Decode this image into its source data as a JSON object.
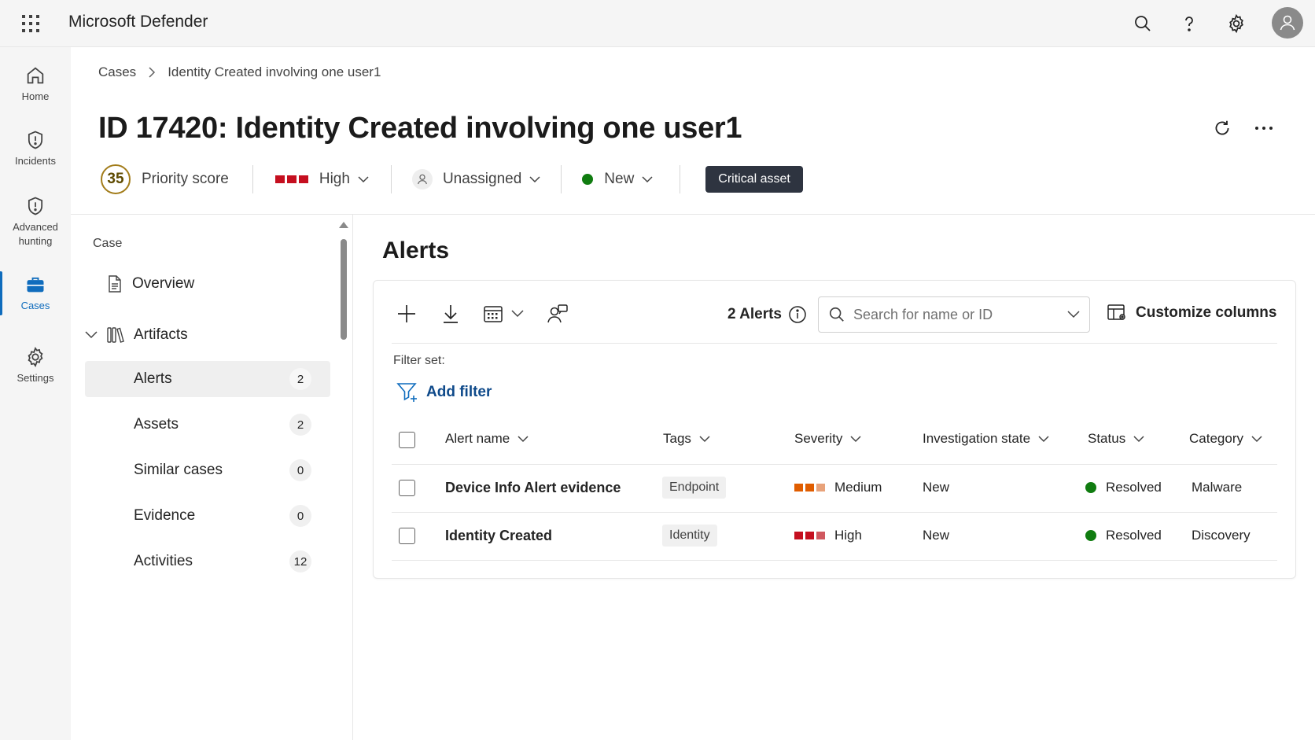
{
  "app": {
    "title": "Microsoft Defender"
  },
  "rail": {
    "items": [
      {
        "label": "Home"
      },
      {
        "label": "Incidents"
      },
      {
        "label": "Advanced hunting"
      },
      {
        "label": "Cases"
      },
      {
        "label": "Settings"
      }
    ]
  },
  "breadcrumb": {
    "root": "Cases",
    "current": "Identity Created involving one user1"
  },
  "case": {
    "title": "ID 17420: Identity Created involving one user1",
    "priority_score": "35",
    "priority_label": "Priority score",
    "severity": "High",
    "assignee": "Unassigned",
    "status": "New",
    "badge": "Critical asset"
  },
  "nav": {
    "section": "Case",
    "overview": "Overview",
    "artifacts": "Artifacts",
    "items": [
      {
        "label": "Alerts",
        "count": "2"
      },
      {
        "label": "Assets",
        "count": "2"
      },
      {
        "label": "Similar cases",
        "count": "0"
      },
      {
        "label": "Evidence",
        "count": "0"
      },
      {
        "label": "Activities",
        "count": "12"
      }
    ]
  },
  "alerts": {
    "title": "Alerts",
    "count_label": "2 Alerts",
    "search_placeholder": "Search for name or ID",
    "customize_label": "Customize columns",
    "filter_set_label": "Filter set:",
    "add_filter_label": "Add filter",
    "columns": {
      "name": "Alert name",
      "tags": "Tags",
      "severity": "Severity",
      "investigation": "Investigation state",
      "status": "Status",
      "category": "Category"
    },
    "rows": [
      {
        "name": "Device Info Alert evidence",
        "tag": "Endpoint",
        "severity": "Medium",
        "investigation": "New",
        "status": "Resolved",
        "category": "Malware"
      },
      {
        "name": "Identity Created",
        "tag": "Identity",
        "severity": "High",
        "investigation": "New",
        "status": "Resolved",
        "category": "Discovery"
      }
    ]
  },
  "colors": {
    "accent": "#0f6cbd",
    "severity_high": "#c50f1f",
    "severity_medium": "#e05d00",
    "status_green": "#107c10",
    "badge_bg": "#2e3440"
  }
}
